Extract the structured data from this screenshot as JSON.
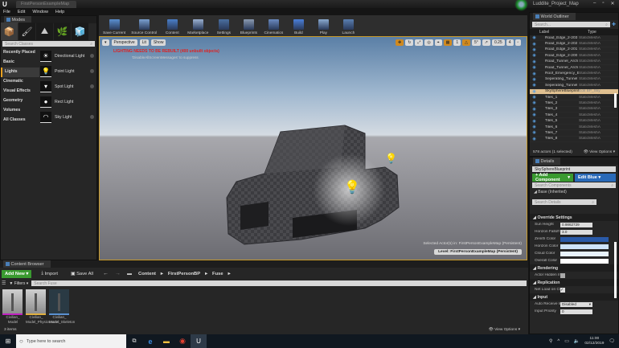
{
  "window": {
    "doc_tab": "FirstPersonExampleMap",
    "project": "Luddite_Project_Map",
    "controls": [
      "–",
      "▫",
      "✕"
    ]
  },
  "menu": [
    "File",
    "Edit",
    "Window",
    "Help"
  ],
  "modes": {
    "tab": "Modes",
    "icons": [
      "place-mode-icon",
      "paint-mode-icon",
      "landscape-mode-icon",
      "foliage-mode-icon",
      "geometry-mode-icon"
    ],
    "search_placeholder": "Search Classes",
    "categories": [
      "Recently Placed",
      "Basic",
      "Lights",
      "Cinematic",
      "Visual Effects",
      "Geometry",
      "Volumes",
      "All Classes"
    ],
    "selected_category": "Lights",
    "items": [
      {
        "label": "Directional Light",
        "glyph": "☀"
      },
      {
        "label": "Point Light",
        "glyph": "💡"
      },
      {
        "label": "Spot Light",
        "glyph": "▾"
      },
      {
        "label": "Rect Light",
        "glyph": "●"
      },
      {
        "label": "Sky Light",
        "glyph": "◠"
      }
    ]
  },
  "toolbar": [
    {
      "label": "Save Current",
      "color": "#5a8fd0"
    },
    {
      "label": "Source Control",
      "color": "#7aa0d0"
    },
    {
      "label": "Content",
      "color": "#4a7fc8"
    },
    {
      "label": "Marketplace",
      "color": "#9ab0d0"
    },
    {
      "label": "Settings",
      "color": "#4a6fa0"
    },
    {
      "label": "Blueprints",
      "color": "#8a9ab0"
    },
    {
      "label": "Cinematics",
      "color": "#6a8ac0"
    },
    {
      "label": "Build",
      "color": "#4a7fd8"
    },
    {
      "label": "Play",
      "color": "#8aaad0"
    },
    {
      "label": "Launch",
      "color": "#5a7fb0"
    }
  ],
  "viewport": {
    "perspective": "Perspective",
    "lit": "Lit",
    "show": "Show",
    "warning": "LIGHTING NEEDS TO BE REBUILT (400 unbuilt objects)",
    "suppress": "'DisableAllScreenMessages' to suppress",
    "snap_angle": "5°",
    "scale": "0.25",
    "cam_speed": "4",
    "selected": "Selected Actor(s) in:  FirstPersonExampleMap (Persistent)",
    "level": "Level:  FirstPersonExampleMap (Persistent)"
  },
  "content_browser": {
    "tab": "Content Browser",
    "add_new": "Add New",
    "import": "Import",
    "save_all": "Save All",
    "path": [
      "Content",
      "FirstPersonBP",
      "Fuse"
    ],
    "filters": "Filters",
    "search_placeholder": "Search Fuse",
    "assets": [
      {
        "l1": "Civilian_",
        "l2": "Model",
        "color": "#c020c0"
      },
      {
        "l1": "Civilian_",
        "l2": "Model_PhysicsAsset",
        "color": "#e0b040"
      },
      {
        "l1": "Civilian_",
        "l2": "Model_Skeleton",
        "color": "#5a90d0"
      }
    ],
    "count": "3 items",
    "view_options": "View Options"
  },
  "outliner": {
    "tab": "World Outliner",
    "search_placeholder": "Search...",
    "col_label": "Label",
    "col_type": "Type",
    "rows": [
      {
        "label": "Road_Edge_2-203",
        "type": "StaticMeshA"
      },
      {
        "label": "Road_Edge_2-202",
        "type": "StaticMeshA"
      },
      {
        "label": "Road_Edge_2-201",
        "type": "StaticMeshA"
      },
      {
        "label": "Road_Edge_2-200",
        "type": "StaticMeshA"
      },
      {
        "label": "Road_Tunnel_Arch",
        "type": "StaticMeshA"
      },
      {
        "label": "Road_Tunnel_Arch",
        "type": "StaticMeshA"
      },
      {
        "label": "Roof_Emergency_E",
        "type": "StaticMeshA"
      },
      {
        "label": "Seperating_Tunnel",
        "type": "StaticMeshA"
      },
      {
        "label": "Seperating_Tunnel",
        "type": "StaticMeshA"
      },
      {
        "label": "SkySphereBlueprint",
        "type": "Edit BP_Sky"
      },
      {
        "label": "Tiles_1",
        "type": "StaticMeshA"
      },
      {
        "label": "Tiles_2",
        "type": "StaticMeshA"
      },
      {
        "label": "Tiles_3",
        "type": "StaticMeshA"
      },
      {
        "label": "Tiles_4",
        "type": "StaticMeshA"
      },
      {
        "label": "Tiles_5",
        "type": "StaticMeshA"
      },
      {
        "label": "Tiles_6",
        "type": "StaticMeshA"
      },
      {
        "label": "Tiles_7",
        "type": "StaticMeshA"
      },
      {
        "label": "Tiles_8",
        "type": "StaticMeshA"
      }
    ],
    "selected_index": 9,
    "count": "578 actors (1 selected)",
    "view_options": "View Options"
  },
  "details": {
    "tab": "Details",
    "name": "SkySphereBlueprint",
    "add_component": "+ Add Component",
    "edit_blueprint": "Edit Blue",
    "search_components": "Search Components",
    "base": "Base (Inherited)",
    "search_details": "Search Details",
    "override": "Override Settings",
    "sun_height_label": "Sun Height",
    "sun_height": "0.9862729",
    "horizon_falloff_label": "Horizon Falloff",
    "horizon_falloff": "3.0",
    "colors": [
      {
        "label": "Zenith Color",
        "value": "#2a5aa8"
      },
      {
        "label": "Horizon Color",
        "value": "#cfe4fa"
      },
      {
        "label": "Cloud Color",
        "value": "#e8f2fc"
      },
      {
        "label": "Overall Color",
        "value": "#ffffff"
      }
    ],
    "rendering": "Rendering",
    "actor_hidden": "Actor Hidden In",
    "replication": "Replication",
    "net_load": "Net Load on Cl",
    "net_load_checked": true,
    "input": "Input",
    "auto_receive": "Auto Receive In",
    "auto_receive_value": "Disabled",
    "input_priority": "Input Priority",
    "input_priority_value": "0"
  },
  "taskbar": {
    "search_placeholder": "Type here to search",
    "time": "11:00",
    "date": "02/12/2019"
  }
}
